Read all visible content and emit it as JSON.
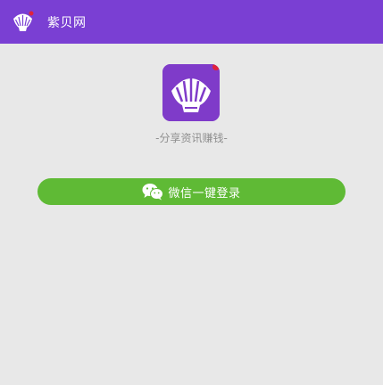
{
  "app_bar": {
    "title": "紫贝网",
    "logo_icon": "shell-logo-icon",
    "background": "#7a3fd3"
  },
  "main": {
    "app_icon": "shell-app-icon",
    "slogan": "-分享资讯赚钱-",
    "login_button": {
      "label": "微信一键登录",
      "icon": "wechat-icon",
      "color": "#5fba35"
    }
  }
}
